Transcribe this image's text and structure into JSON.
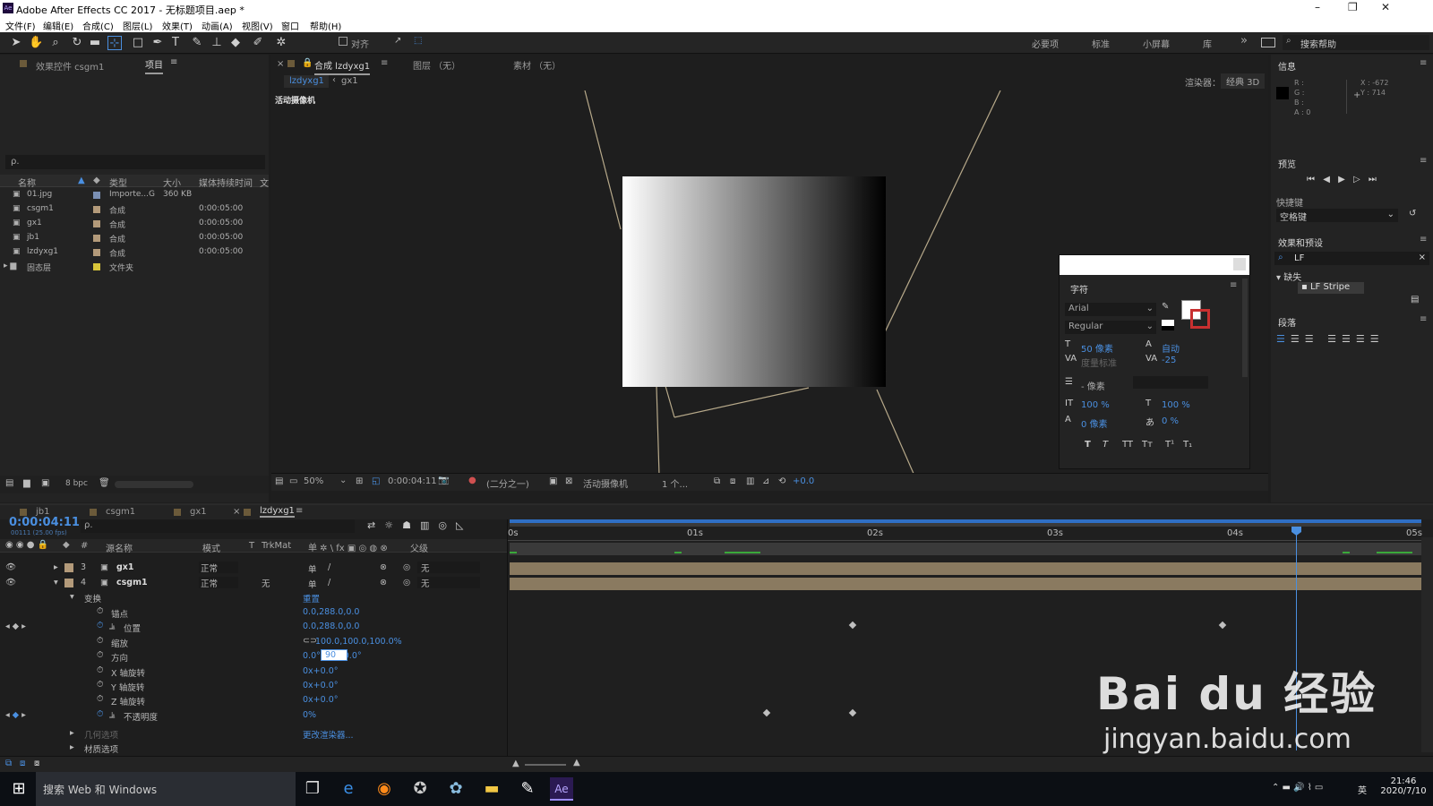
{
  "window": {
    "title": "Adobe After Effects CC 2017 - 无标题项目.aep *",
    "app_icon": "Ae",
    "controls": [
      "–",
      "❐",
      "✕"
    ]
  },
  "menu": [
    "文件(F)",
    "编辑(E)",
    "合成(C)",
    "图层(L)",
    "效果(T)",
    "动画(A)",
    "视图(V)",
    "窗口",
    "帮助(H)"
  ],
  "toolbar": {
    "snap_label": "对齐",
    "workspaces": [
      "必要项",
      "标准",
      "小屏幕",
      "库"
    ],
    "overflow": "»",
    "search_placeholder": "搜索帮助"
  },
  "project_panel": {
    "tabs": [
      "效果控件 csgm1",
      "项目"
    ],
    "search_placeholder": "ρ.",
    "columns": [
      "名称",
      "类型",
      "大小",
      "媒体持续时间",
      "文"
    ],
    "items": [
      {
        "name": "01.jpg",
        "type": "Importe...G",
        "size": "360 KB",
        "duration": "",
        "color": "#7a8fb3"
      },
      {
        "name": "csgm1",
        "type": "合成",
        "size": "",
        "duration": "0:00:05:00",
        "color": "#b39a7a"
      },
      {
        "name": "gx1",
        "type": "合成",
        "size": "",
        "duration": "0:00:05:00",
        "color": "#b39a7a"
      },
      {
        "name": "jb1",
        "type": "合成",
        "size": "",
        "duration": "0:00:05:00",
        "color": "#b39a7a"
      },
      {
        "name": "lzdyxg1",
        "type": "合成",
        "size": "",
        "duration": "0:00:05:00",
        "color": "#b39a7a"
      },
      {
        "name": "固态层",
        "type": "文件夹",
        "size": "",
        "duration": "",
        "color": "#d8c53a"
      }
    ],
    "bpc": "8 bpc"
  },
  "comp_panel": {
    "tabs": [
      "合成 lzdyxg1",
      "图层 （无）",
      "素材 （无）"
    ],
    "breadcrumbs": [
      "lzdyxg1",
      "gx1"
    ],
    "renderer_label": "渲染器：",
    "renderer_value": "经典 3D",
    "camera_label": "活动摄像机",
    "footer": {
      "zoom": "50%",
      "timecode": "0:00:04:11",
      "resolution": "(二分之一)",
      "camera": "活动摄像机",
      "views": "1 个...",
      "exposure": "+0.0"
    }
  },
  "character_panel": {
    "title": "字符",
    "font": "Arial",
    "style": "Regular",
    "size": "50 像素",
    "leading": "自动",
    "kerning": "度量标准",
    "tracking": "-25",
    "stroke": "- 像素",
    "vscale": "100 %",
    "hscale": "100 %",
    "baseline": "0 像素",
    "tsume": "0 %",
    "styles": [
      "T",
      "T",
      "TT",
      "Tт",
      "T¹",
      "T₁"
    ]
  },
  "info_panel": {
    "title": "信息",
    "rgba": [
      "R :",
      "G :",
      "B :",
      "A : 0"
    ],
    "x": "X : -672",
    "y": "Y : 714"
  },
  "preview_panel": {
    "title": "预览",
    "shortcut_label": "快捷键",
    "shortcut_value": "空格键"
  },
  "effects_panel": {
    "title": "效果和预设",
    "search": "LF",
    "category": "缺失",
    "item": "LF Stripe"
  },
  "paragraph_panel": {
    "title": "段落"
  },
  "timeline": {
    "tabs": [
      "jb1",
      "csgm1",
      "gx1",
      "lzdyxg1"
    ],
    "timecode": "0:00:04:11",
    "fps": "00111 (25.00 fps)",
    "columns": [
      "#",
      "源名称",
      "模式",
      "T",
      "TrkMat",
      "父级"
    ],
    "ruler": [
      "0s",
      "01s",
      "02s",
      "03s",
      "04s",
      "05s"
    ],
    "layers": [
      {
        "num": "3",
        "name": "gx1",
        "mode": "正常",
        "trkmat": "",
        "parent": "无"
      },
      {
        "num": "4",
        "name": "csgm1",
        "mode": "正常",
        "trkmat": "无",
        "parent": "无"
      }
    ],
    "transform": {
      "label": "变换",
      "reset": "重置"
    },
    "props": [
      {
        "name": "锚点",
        "value": "0.0,288.0,0.0"
      },
      {
        "name": "位置",
        "value": "0.0,288.0,0.0"
      },
      {
        "name": "缩放",
        "value": "100.0,100.0,100.0%"
      },
      {
        "name": "方向",
        "value": "0.0°,0.0°,0.0°",
        "edit": "90"
      },
      {
        "name": "X 轴旋转",
        "value": "0x+0.0°"
      },
      {
        "name": "Y 轴旋转",
        "value": "0x+0.0°"
      },
      {
        "name": "Z 轴旋转",
        "value": "0x+0.0°"
      },
      {
        "name": "不透明度",
        "value": "0%"
      }
    ],
    "geometry_label": "几何选项",
    "change_renderer": "更改渲染器...",
    "material_label": "材质选项"
  },
  "watermark": {
    "brand": "Bai du 经验",
    "url": "jingyan.baidu.com"
  },
  "taskbar": {
    "search": "搜索 Web 和 Windows",
    "time": "21:46",
    "date": "2020/7/10",
    "lang": "英"
  }
}
